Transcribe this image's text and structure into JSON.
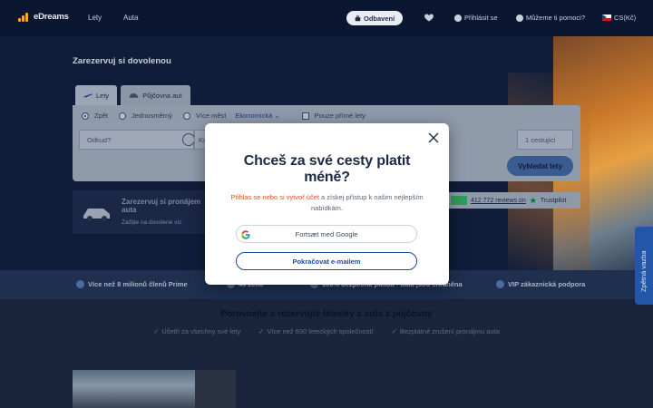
{
  "topnav": {
    "logo": "eDreams",
    "links": [
      "Lety",
      "Auta"
    ],
    "pill": "Odbavení",
    "signin": "Přihlásit se",
    "help": "Můžeme ti pomoci?",
    "lang": "CS(Kč)"
  },
  "hero": {
    "title": "Zarezervuj si dovolenou",
    "tabs": [
      {
        "label": "Lety",
        "icon": "plane-icon"
      },
      {
        "label": "Půjčovna aut",
        "icon": "car-icon"
      }
    ],
    "trip_types": [
      "Zpět",
      "Jednosměrný",
      "Více měst"
    ],
    "cabin": "Ekonomická",
    "direct_only": "Pouze přímé lety",
    "origin_placeholder": "Odkud?",
    "dest_placeholder": "Ka",
    "passengers": "1 cestující",
    "submit": "Vyhledat lety"
  },
  "car_banner": {
    "title": "Zarezervuj si pronájem auta",
    "subtitle": "Zažijte na dovolené víc"
  },
  "trustpilot": {
    "reviews": "412 772 reviews on",
    "brand": "Trustpilot"
  },
  "benefits": [
    {
      "label": "Více než 8 milionů členů Prime",
      "icon": "people-icon"
    },
    {
      "label": "46 zemí",
      "icon": "globe-icon"
    },
    {
      "label": "100% bezpečná platba - data jsou chráněna",
      "icon": "shield-icon"
    },
    {
      "label": "VIP zákaznická podpora",
      "icon": "headset-icon"
    }
  ],
  "compare": {
    "title": "Porovnejte a rezervujte letenky a auta z půjčovny",
    "checks": [
      "Ušetři za všechny své lety",
      "Více než 690 leteckých společností",
      "Bezplatné zrušení pronájmu auta"
    ]
  },
  "feedback": "Zpětná vazba",
  "modal": {
    "title": "Chceš za své cesty platit méně?",
    "text_prefix": "Přihlas se nebo si vytvoř účet",
    "text_suffix": " a získej přístup k našim nejlepším nabídkám.",
    "google_button": "Fortsæt med Google",
    "email_button": "Pokračovat e-mailem"
  },
  "colors": {
    "accent": "#1c4a9e",
    "link": "#d9532c",
    "nav_bg": "#0b1630"
  }
}
